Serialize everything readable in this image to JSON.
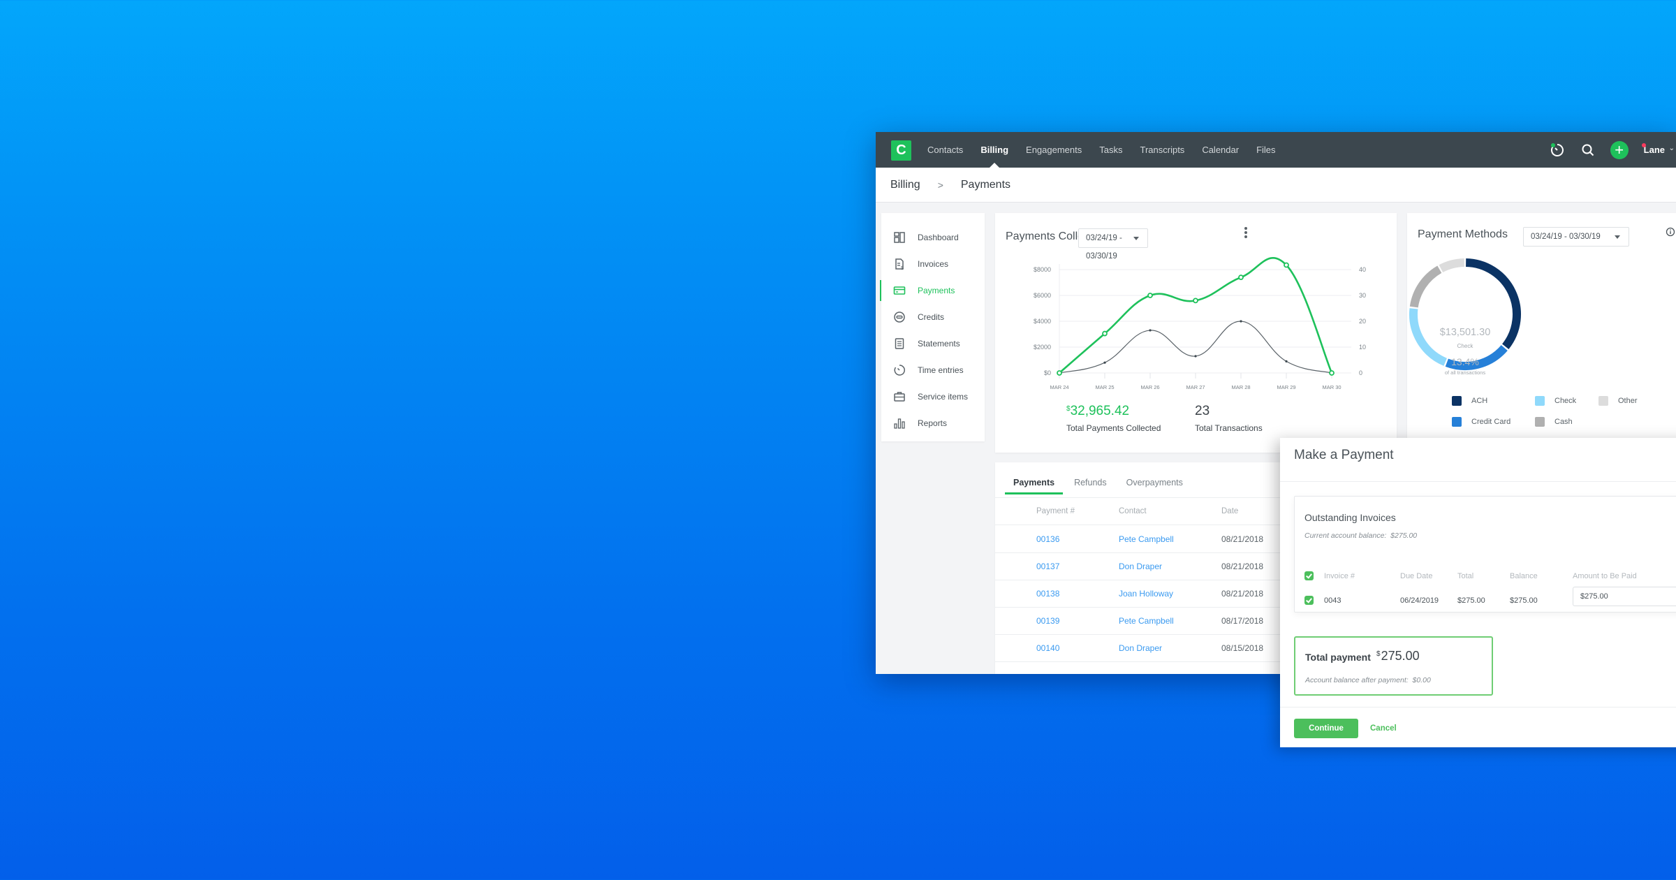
{
  "topnav": {
    "logo_letter": "C",
    "items": [
      {
        "label": "Contacts",
        "active": false
      },
      {
        "label": "Billing",
        "active": true
      },
      {
        "label": "Engagements",
        "active": false
      },
      {
        "label": "Tasks",
        "active": false
      },
      {
        "label": "Transcripts",
        "active": false
      },
      {
        "label": "Calendar",
        "active": false
      },
      {
        "label": "Files",
        "active": false
      }
    ],
    "icons": [
      "timer-icon",
      "search-icon",
      "plus-icon"
    ],
    "user_name": "Lane"
  },
  "breadcrumb": {
    "parent": "Billing",
    "separator": ">",
    "current": "Payments"
  },
  "sidebar": {
    "items": [
      {
        "label": "Dashboard",
        "icon": "dashboard-icon"
      },
      {
        "label": "Invoices",
        "icon": "invoice-icon"
      },
      {
        "label": "Payments",
        "icon": "credit-card-icon",
        "active": true
      },
      {
        "label": "Credits",
        "icon": "credit-icon"
      },
      {
        "label": "Statements",
        "icon": "statement-icon"
      },
      {
        "label": "Time entries",
        "icon": "stopwatch-icon"
      },
      {
        "label": "Service items",
        "icon": "briefcase-icon"
      },
      {
        "label": "Reports",
        "icon": "bar-chart-icon"
      }
    ]
  },
  "payments_collected": {
    "title": "Payments Collected",
    "date_range": "03/24/19 - 03/30/19",
    "total_currency": "$",
    "total_amount": "32,965.42",
    "total_label": "Total Payments Collected",
    "transactions": "23",
    "transactions_label": "Total Transactions"
  },
  "payment_methods": {
    "title": "Payment Methods",
    "date_range": "03/24/19 - 03/30/19",
    "center_amount": "$13,501.30",
    "center_method": "Check",
    "center_percent": "13.4%",
    "center_percent_label": "of all transactions"
  },
  "payments_table": {
    "tabs": [
      {
        "label": "Payments",
        "active": true
      },
      {
        "label": "Refunds",
        "active": false
      },
      {
        "label": "Overpayments",
        "active": false
      }
    ],
    "columns": [
      "Payment #",
      "Contact",
      "Date"
    ],
    "rows": [
      {
        "number": "00136",
        "contact": "Pete Campbell",
        "date": "08/21/2018"
      },
      {
        "number": "00137",
        "contact": "Don Draper",
        "date": "08/21/2018"
      },
      {
        "number": "00138",
        "contact": "Joan Holloway",
        "date": "08/21/2018"
      },
      {
        "number": "00139",
        "contact": "Pete Campbell",
        "date": "08/17/2018"
      },
      {
        "number": "00140",
        "contact": "Don Draper",
        "date": "08/15/2018"
      }
    ]
  },
  "modal": {
    "title": "Make a Payment",
    "section_title": "Outstanding Invoices",
    "balance_label": "Current account balance:",
    "balance_value": "$275.00",
    "columns": [
      "Invoice #",
      "Due Date",
      "Total",
      "Balance",
      "Amount to Be Paid"
    ],
    "invoices": [
      {
        "number": "0043",
        "due_date": "06/24/2019",
        "total": "$275.00",
        "balance": "$275.00",
        "amount_to_pay": "$275.00",
        "checked": true
      }
    ],
    "total_label": "Total payment",
    "total_currency": "$",
    "total_value": "275.00",
    "after_label": "Account balance after payment:",
    "after_value": "$0.00",
    "continue_label": "Continue",
    "cancel_label": "Cancel"
  },
  "colors": {
    "brand_green": "#1ec15b",
    "nav_dark": "#3c474e",
    "link_blue": "#3a9af0"
  },
  "chart_data": [
    {
      "type": "line",
      "title": "Payments Collected",
      "categories": [
        "MAR 24",
        "MAR 25",
        "MAR 26",
        "MAR 27",
        "MAR 28",
        "MAR 29",
        "MAR 30"
      ],
      "y_left": {
        "ticks": [
          "$0",
          "$2000",
          "$4000",
          "$6000",
          "$8000"
        ],
        "range": [
          0,
          8000
        ]
      },
      "y_right": {
        "ticks": [
          "0",
          "10",
          "20",
          "30",
          "40"
        ],
        "range": [
          0,
          40
        ]
      },
      "grid": true,
      "series": [
        {
          "name": "Payments collected",
          "axis": "left",
          "color": "#1ec15b",
          "values": [
            0,
            3050,
            6000,
            5600,
            7400,
            8350,
            0
          ]
        },
        {
          "name": "Transactions",
          "axis": "right",
          "color": "#5a6268",
          "values": [
            0,
            4,
            16.5,
            6.5,
            20,
            4.5,
            0
          ]
        }
      ]
    },
    {
      "type": "pie",
      "title": "Payment Methods",
      "donut": true,
      "slices": [
        {
          "label": "ACH",
          "value": 36,
          "color": "#0b3364"
        },
        {
          "label": "Credit Card",
          "value": 20,
          "color": "#2680d8"
        },
        {
          "label": "Check",
          "value": 21,
          "color": "#8fd9fb"
        },
        {
          "label": "Cash",
          "value": 15,
          "color": "#b0b0b0"
        },
        {
          "label": "Other",
          "value": 8,
          "color": "#dcdcdc"
        }
      ],
      "legend": [
        {
          "label": "ACH",
          "color": "#0b3364"
        },
        {
          "label": "Check",
          "color": "#8fd9fb"
        },
        {
          "label": "Other",
          "color": "#dcdcdc"
        },
        {
          "label": "Credit Card",
          "color": "#2680d8"
        },
        {
          "label": "Cash",
          "color": "#b0b0b0"
        }
      ],
      "legend_position": "bottom"
    }
  ]
}
